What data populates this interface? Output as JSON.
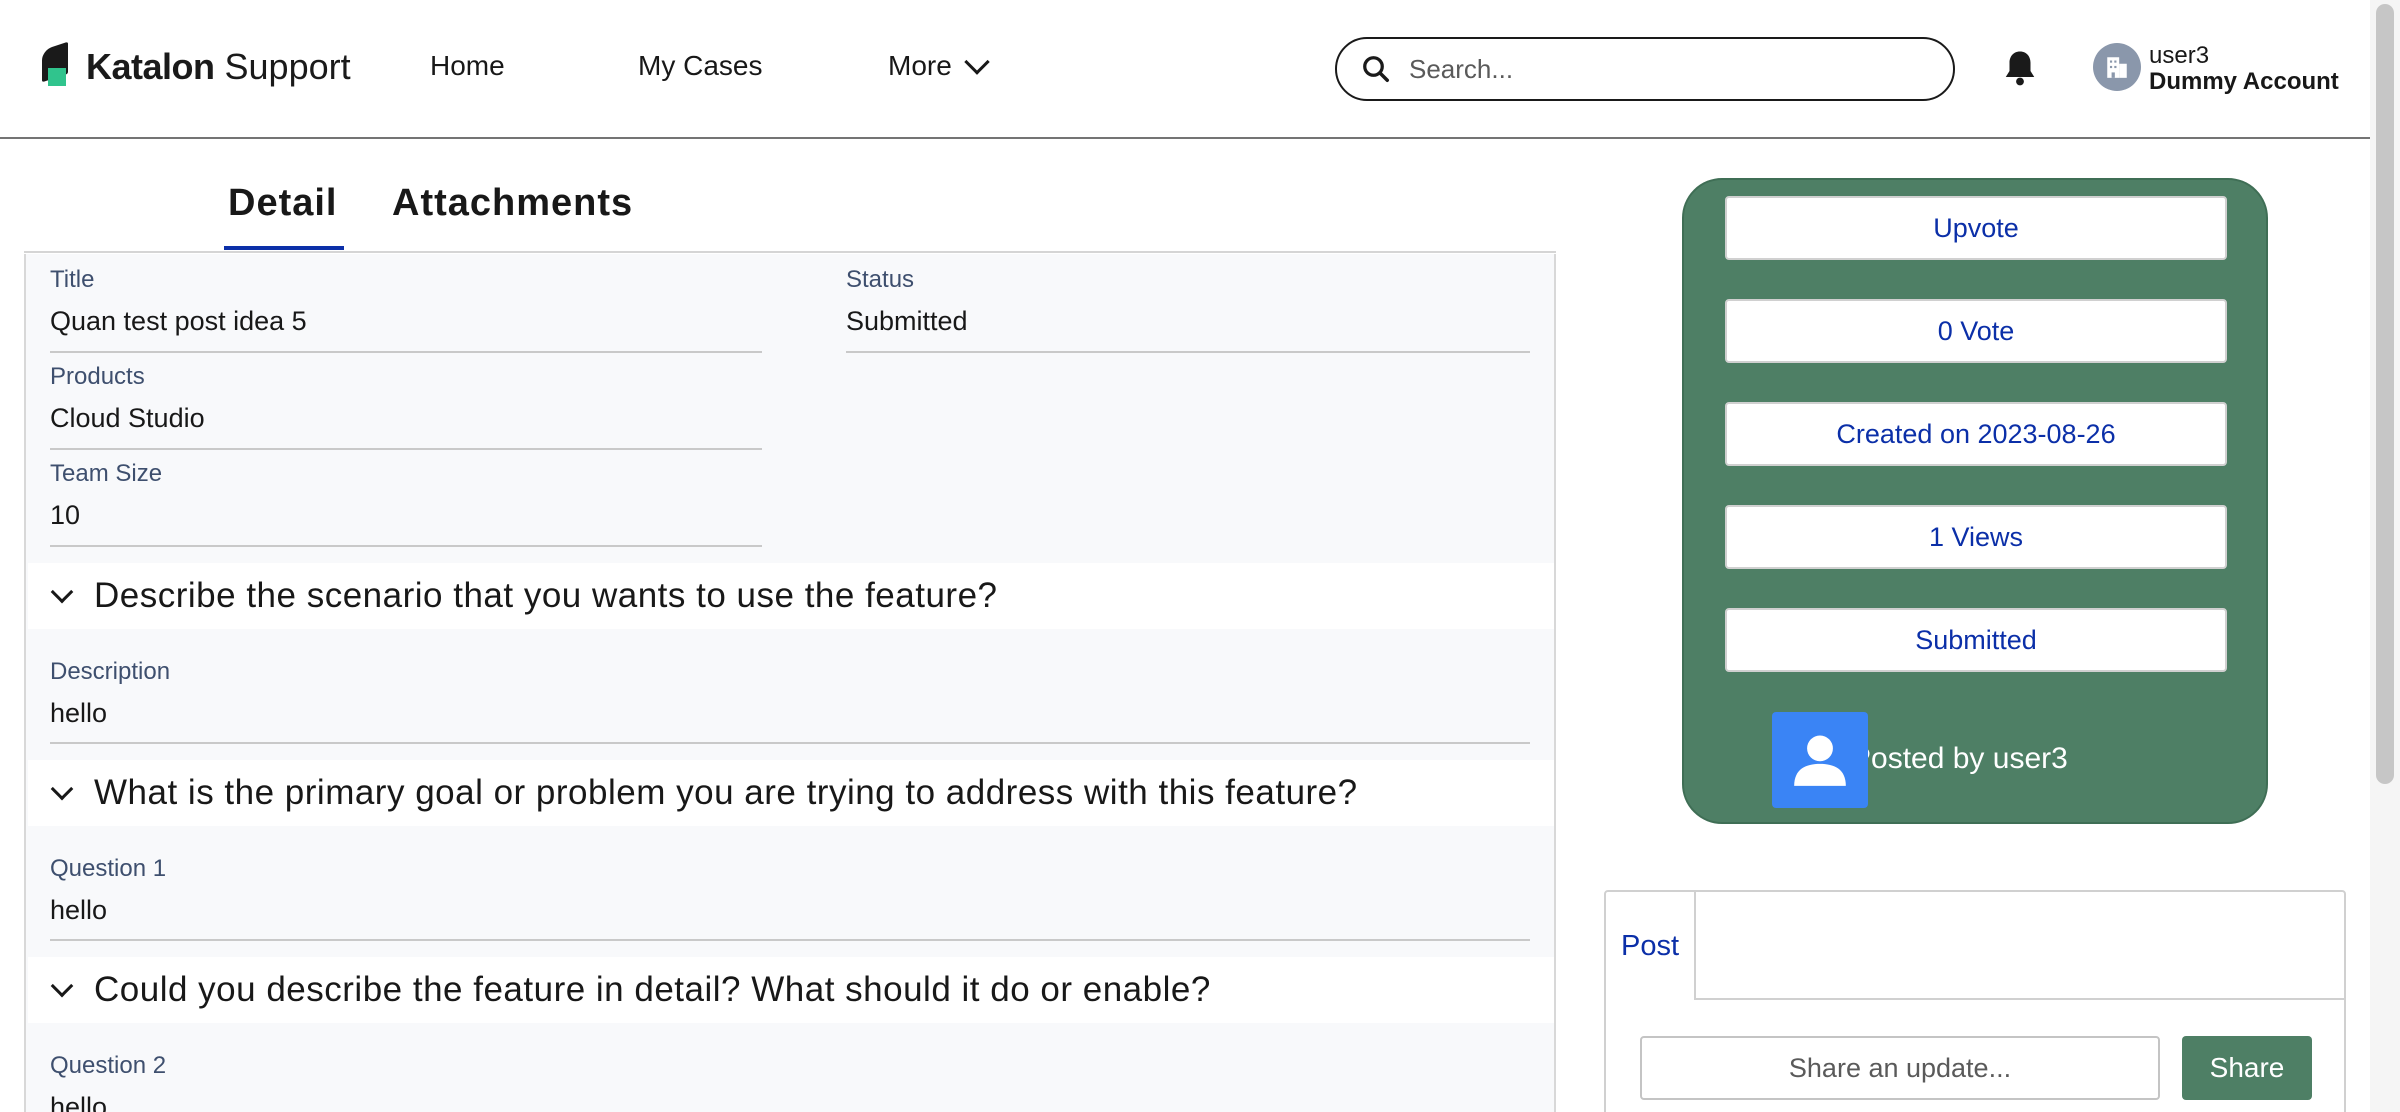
{
  "header": {
    "brand": "Katalon",
    "product": "Support",
    "nav": {
      "home": "Home",
      "cases": "My Cases",
      "more": "More"
    },
    "search": {
      "placeholder": "Search..."
    },
    "user": {
      "name": "user3",
      "account": "Dummy Account"
    }
  },
  "tabs": {
    "detail": "Detail",
    "attachments": "Attachments"
  },
  "fields": {
    "title": {
      "label": "Title",
      "value": "Quan test post idea 5"
    },
    "status": {
      "label": "Status",
      "value": "Submitted"
    },
    "products": {
      "label": "Products",
      "value": "Cloud Studio"
    },
    "team_size": {
      "label": "Team Size",
      "value": "10"
    }
  },
  "sections": [
    {
      "title": "Describe the scenario that you wants to use the feature?",
      "label": "Description",
      "value": "hello"
    },
    {
      "title": "What is the primary goal or problem you are trying to address with this feature?",
      "label": "Question 1",
      "value": "hello"
    },
    {
      "title": "Could you describe the feature in detail? What should it do or enable?",
      "label": "Question 2",
      "value": "hello"
    }
  ],
  "card": {
    "upvote": "Upvote",
    "votes": "0 Vote",
    "created": "Created on 2023-08-26",
    "views": "1 Views",
    "status": "Submitted",
    "posted_by": "Posted by user3"
  },
  "post": {
    "tab": "Post",
    "share_placeholder": "Share an update...",
    "share_button": "Share"
  },
  "colors": {
    "accent_blue": "#0b2fa8",
    "card_green": "#4e7f65",
    "avatar_blue": "#3a84f5"
  }
}
